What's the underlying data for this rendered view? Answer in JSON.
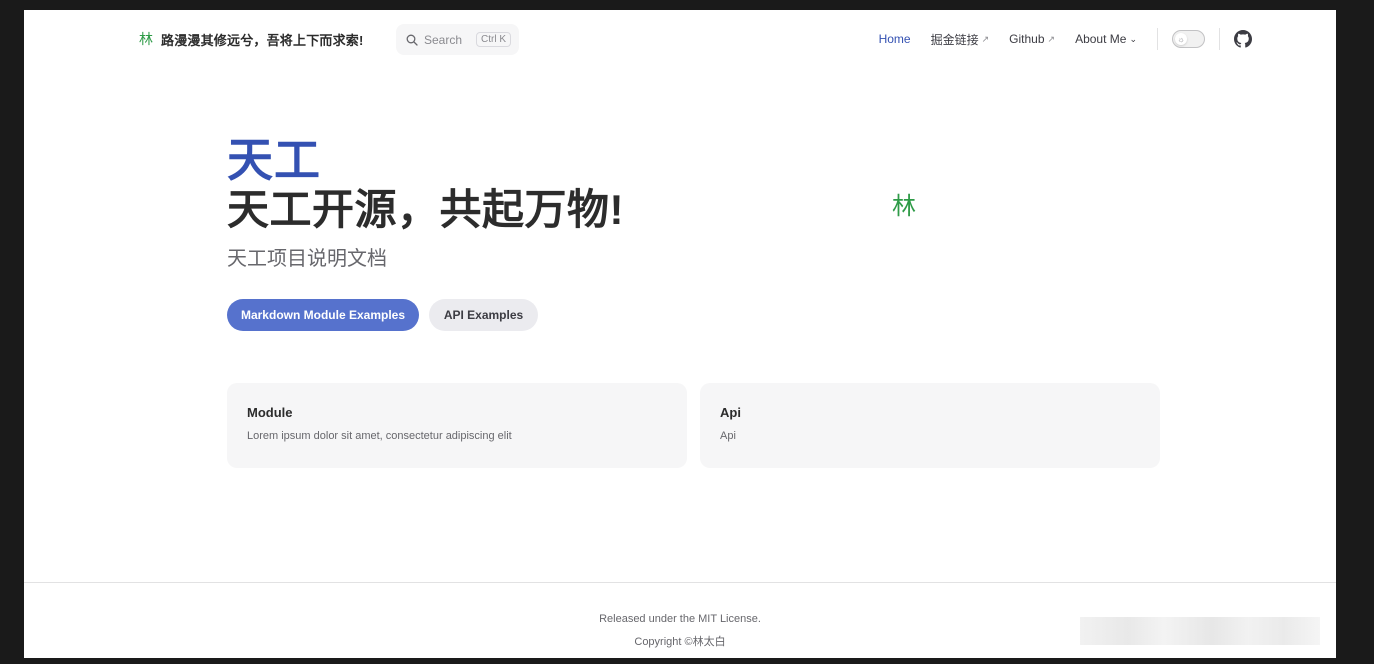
{
  "nav": {
    "logo_glyph": "林",
    "site_title": "路漫漫其修远兮，吾将上下而求索!",
    "search": {
      "label": "Search",
      "shortcut": "Ctrl K"
    },
    "links": [
      {
        "label": "Home",
        "active": true
      },
      {
        "label": "掘金链接",
        "external": true
      },
      {
        "label": "Github",
        "external": true
      },
      {
        "label": "About Me",
        "dropdown": true
      }
    ],
    "accent_color": "#3451b2"
  },
  "hero": {
    "name": "天工",
    "text": "天工开源，共起万物!",
    "tagline": "天工项目说明文档",
    "image_glyph": "林",
    "actions": [
      {
        "label": "Markdown Module Examples",
        "theme": "brand"
      },
      {
        "label": "API Examples",
        "theme": "alt"
      }
    ]
  },
  "features": [
    {
      "title": "Module",
      "details": "Lorem ipsum dolor sit amet, consectetur adipiscing elit"
    },
    {
      "title": "Api",
      "details": "Api"
    }
  ],
  "footer": {
    "message": "Released under the MIT License.",
    "copyright": "Copyright ©林太白"
  }
}
